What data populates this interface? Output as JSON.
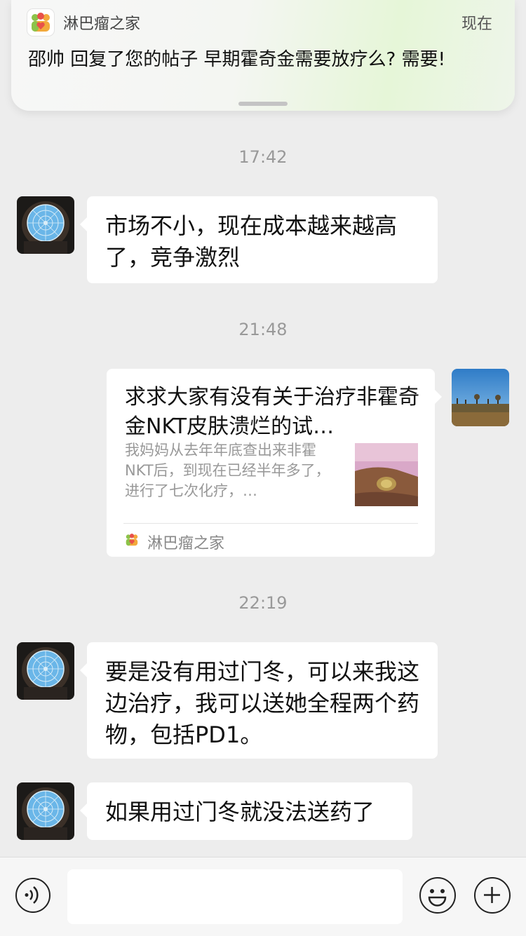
{
  "notification": {
    "app_name": "淋巴瘤之家",
    "time": "现在",
    "message": "邵帅 回复了您的帖子 早期霍奇金需要放疗么? 需要!"
  },
  "messages": [
    {
      "type": "timestamp",
      "text": "17:42"
    },
    {
      "type": "text",
      "side": "left",
      "text": "市场不小，现在成本越来越高了，竞争激烈"
    },
    {
      "type": "timestamp",
      "text": "21:48"
    },
    {
      "type": "link_card",
      "side": "right",
      "title": "求求大家有没有关于治疗非霍奇金NKT皮肤溃烂的试…",
      "description": "我妈妈从去年年底查出来非霍NKT后，到现在已经半年多了，进行了七次化疗，…",
      "source": "淋巴瘤之家"
    },
    {
      "type": "timestamp",
      "text": "22:19"
    },
    {
      "type": "text",
      "side": "left",
      "text": "要是没有用过门冬，可以来我这边治疗，我可以送她全程两个药物，包括PD1。"
    },
    {
      "type": "text",
      "side": "left",
      "text": "如果用过门冬就没法送药了"
    }
  ],
  "input_bar": {
    "placeholder": "",
    "icons": [
      "voice-icon",
      "emoji-icon",
      "plus-icon"
    ]
  }
}
